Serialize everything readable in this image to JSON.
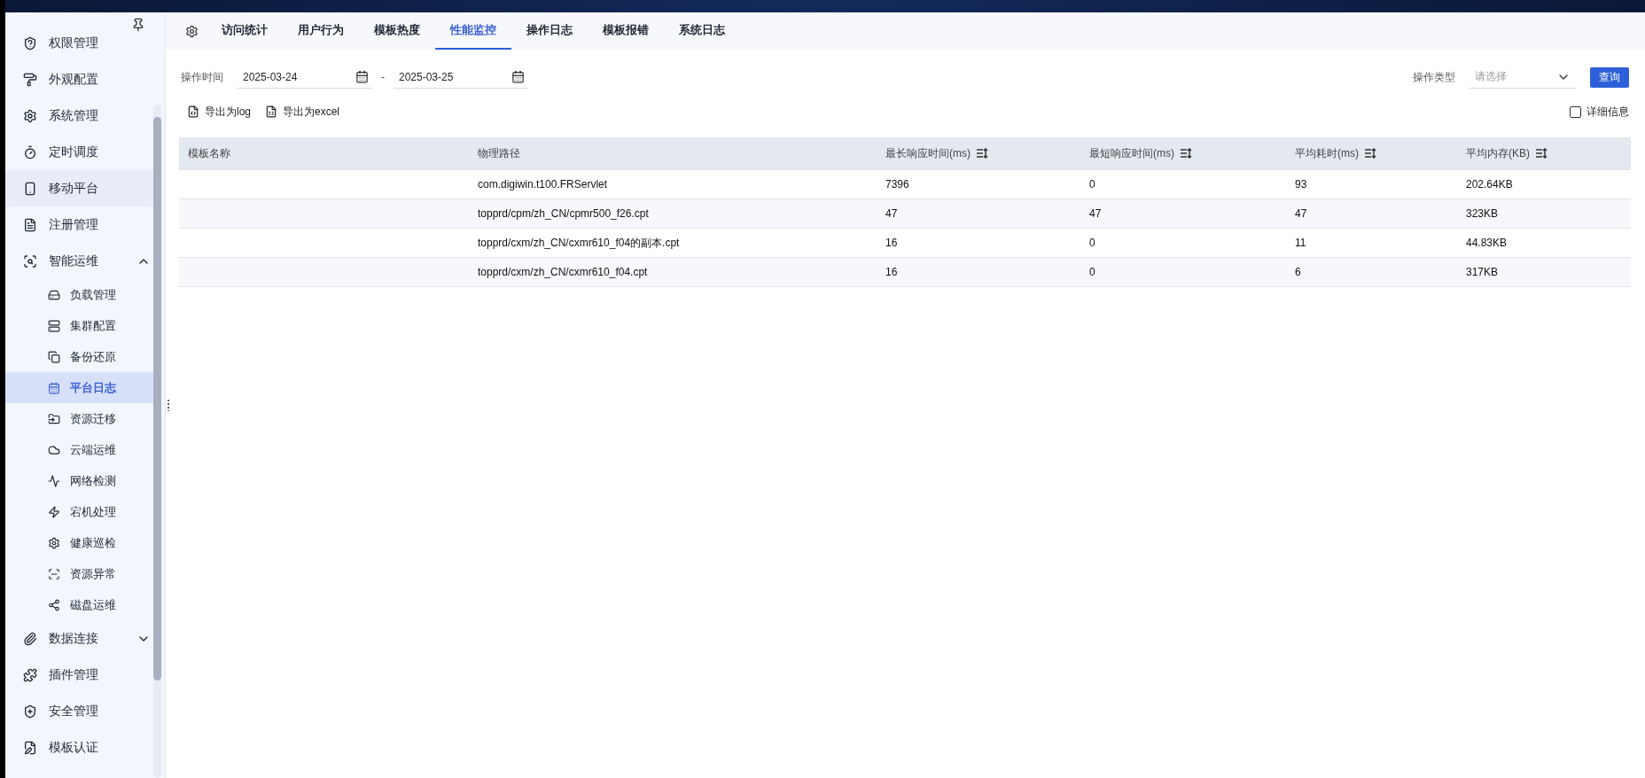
{
  "sidebar": {
    "items": [
      {
        "label": "权限管理",
        "selected": false,
        "highlighted": false
      },
      {
        "label": "外观配置",
        "selected": false,
        "highlighted": false
      },
      {
        "label": "系统管理",
        "selected": false,
        "highlighted": false
      },
      {
        "label": "定时调度",
        "selected": false,
        "highlighted": false
      },
      {
        "label": "移动平台",
        "selected": false,
        "highlighted": true
      },
      {
        "label": "注册管理",
        "selected": false,
        "highlighted": false
      },
      {
        "label": "智能运维",
        "selected": false,
        "highlighted": false,
        "expanded": true,
        "children": [
          {
            "label": "负载管理",
            "selected": false
          },
          {
            "label": "集群配置",
            "selected": false
          },
          {
            "label": "备份还原",
            "selected": false
          },
          {
            "label": "平台日志",
            "selected": true
          },
          {
            "label": "资源迁移",
            "selected": false
          },
          {
            "label": "云端运维",
            "selected": false
          },
          {
            "label": "网络检测",
            "selected": false
          },
          {
            "label": "宕机处理",
            "selected": false
          },
          {
            "label": "健康巡检",
            "selected": false
          },
          {
            "label": "资源异常",
            "selected": false
          },
          {
            "label": "磁盘运维",
            "selected": false
          }
        ]
      },
      {
        "label": "数据连接",
        "selected": false,
        "highlighted": false,
        "expanded": false
      },
      {
        "label": "插件管理",
        "selected": false,
        "highlighted": false
      },
      {
        "label": "安全管理",
        "selected": false,
        "highlighted": false
      },
      {
        "label": "模板认证",
        "selected": false,
        "highlighted": false
      }
    ]
  },
  "tabs": [
    {
      "label": "访问统计",
      "selected": false
    },
    {
      "label": "用户行为",
      "selected": false
    },
    {
      "label": "模板热度",
      "selected": false
    },
    {
      "label": "性能监控",
      "selected": true
    },
    {
      "label": "操作日志",
      "selected": false
    },
    {
      "label": "模板报错",
      "selected": false
    },
    {
      "label": "系统日志",
      "selected": false
    }
  ],
  "filters": {
    "time_label": "操作时间",
    "date_from": "2025-03-24",
    "date_separator": "-",
    "date_to": "2025-03-25",
    "type_label": "操作类型",
    "type_placeholder": "请选择",
    "query_button": "查询"
  },
  "exports": [
    "导出为log",
    "导出为excel"
  ],
  "detail_checkbox": {
    "label": "详细信息",
    "checked": false
  },
  "table": {
    "columns": [
      {
        "label": "模板名称",
        "sortable": false
      },
      {
        "label": "物理路径",
        "sortable": false
      },
      {
        "label": "最长响应时间(ms)",
        "sortable": true
      },
      {
        "label": "最短响应时间(ms)",
        "sortable": true
      },
      {
        "label": "平均耗时(ms)",
        "sortable": true
      },
      {
        "label": "平均内存(KB)",
        "sortable": true
      }
    ],
    "rows": [
      [
        "",
        "com.digiwin.t100.FRServlet",
        "7396",
        "0",
        "93",
        "202.64KB"
      ],
      [
        "",
        "topprd/cpm/zh_CN/cpmr500_f26.cpt",
        "47",
        "47",
        "47",
        "323KB"
      ],
      [
        "",
        "topprd/cxm/zh_CN/cxmr610_f04的副本.cpt",
        "16",
        "0",
        "11",
        "44.83KB"
      ],
      [
        "",
        "topprd/cxm/zh_CN/cxmr610_f04.cpt",
        "16",
        "0",
        "6",
        "317KB"
      ]
    ]
  }
}
